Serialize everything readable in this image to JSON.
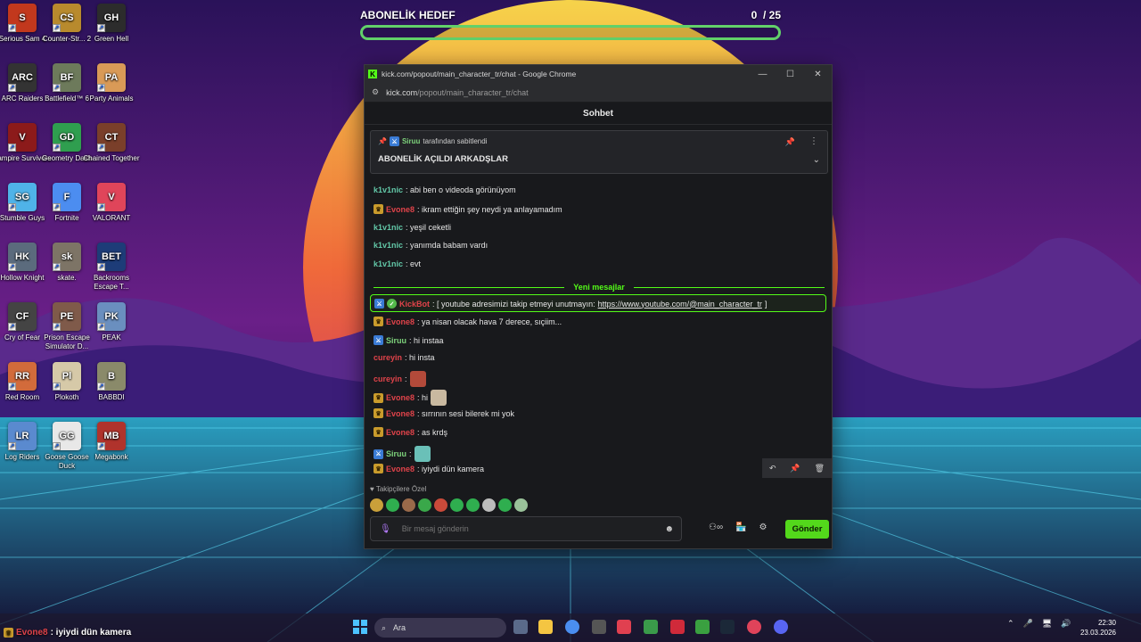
{
  "goal": {
    "label": "ABONELİK HEDEF",
    "current": "0",
    "target": "/ 25",
    "progress": 0
  },
  "desktop": {
    "icons": [
      {
        "label": "Serious Sam 4",
        "glyph": "S",
        "color": "#c2381d"
      },
      {
        "label": "Counter-Str... 2",
        "glyph": "CS",
        "color": "#b88a2d"
      },
      {
        "label": "Green Hell",
        "glyph": "GH",
        "color": "#2c2c2c"
      },
      {
        "label": "ARC Raiders",
        "glyph": "ARC",
        "color": "#333333"
      },
      {
        "label": "Battlefield™ 6",
        "glyph": "BF",
        "color": "#6d7a5b"
      },
      {
        "label": "Party Animals",
        "glyph": "PA",
        "color": "#d99a57"
      },
      {
        "label": "Vampire Survivors",
        "glyph": "V",
        "color": "#8c1a1a"
      },
      {
        "label": "Geometry Dash",
        "glyph": "GD",
        "color": "#2f9e4f"
      },
      {
        "label": "Chained Together",
        "glyph": "CT",
        "color": "#7a3f2a"
      },
      {
        "label": "Stumble Guys",
        "glyph": "SG",
        "color": "#4fb3e8"
      },
      {
        "label": "Fortnite",
        "glyph": "F",
        "color": "#4c8df0"
      },
      {
        "label": "VALORANT",
        "glyph": "V",
        "color": "#e0455a"
      },
      {
        "label": "Hollow Knight",
        "glyph": "HK",
        "color": "#5b6b7d"
      },
      {
        "label": "skate.",
        "glyph": "sk",
        "color": "#7d7466"
      },
      {
        "label": "Backrooms Escape T...",
        "glyph": "BET",
        "color": "#1d3c78"
      },
      {
        "label": "Cry of Fear",
        "glyph": "CF",
        "color": "#444444"
      },
      {
        "label": "Prison Escape Simulator D...",
        "glyph": "PE",
        "color": "#7f5a4a"
      },
      {
        "label": "PEAK",
        "glyph": "PK",
        "color": "#6a8fbf"
      },
      {
        "label": "Red Room",
        "glyph": "RR",
        "color": "#d26b3b"
      },
      {
        "label": "Plokoth",
        "glyph": "Pl",
        "color": "#d6c9a8"
      },
      {
        "label": "BABBDI",
        "glyph": "B",
        "color": "#8a8a6a"
      },
      {
        "label": "Log Riders",
        "glyph": "LR",
        "color": "#5a8acf"
      },
      {
        "label": "Goose Goose Duck",
        "glyph": "GG",
        "color": "#e8e8e8"
      },
      {
        "label": "Megabonk",
        "glyph": "MB",
        "color": "#b0332c"
      }
    ]
  },
  "window": {
    "title": "kick.com/popout/main_character_tr/chat - Google Chrome",
    "url_host": "kick.com",
    "url_path": "/popout/main_character_tr/chat",
    "chat_title": "Sohbet"
  },
  "pinned": {
    "by_user": "Siruu",
    "by_suffix": "tarafından sabitlendi",
    "message": "ABONELİK AÇILDI ARKADŞLAR"
  },
  "chat": {
    "new_messages_label": "Yeni mesajlar",
    "messages": [
      {
        "user": "k1v1nic",
        "text": ": abi ben o videoda görünüyom",
        "color": "#62c7a7"
      },
      {
        "user": "Evone8",
        "text": ": ikram ettiğin şey neydi ya anlayamadım",
        "color": "#e0434a"
      },
      {
        "user": "k1v1nic",
        "text": ": yeşil ceketli",
        "color": "#62c7a7"
      },
      {
        "user": "k1v1nic",
        "text": ": yanımda babam vardı",
        "color": "#62c7a7"
      },
      {
        "user": "k1v1nic",
        "text": ": evt",
        "color": "#62c7a7"
      }
    ],
    "bot": {
      "user": "KickBot",
      "text": ": [ youtube adresimizi takip etmeyi unutmayın: ",
      "link": "https://www.youtube.com/@main_character_tr",
      "close": " ]"
    },
    "new": [
      {
        "user": "Evone8",
        "text": ": ya nisan olacak hava 7 derece, sıçiim...",
        "color": "#e0434a"
      },
      {
        "user": "Siruu",
        "text": ": hi instaa",
        "color": "#7ed37c"
      },
      {
        "user": "cureyin",
        "text": ": hi insta",
        "color": "#e0434a"
      },
      {
        "user": "cureyin",
        "text": ":",
        "color": "#e0434a"
      },
      {
        "user": "Evone8",
        "text": ": hi",
        "color": "#e0434a"
      },
      {
        "user": "Evone8",
        "text": ": sırrının sesi bilerek mi yok",
        "color": "#e0434a"
      },
      {
        "user": "Evone8",
        "text": ": as krdş",
        "color": "#e0434a"
      },
      {
        "user": "Siruu",
        "text": ":",
        "color": "#7ed37c"
      },
      {
        "user": "Evone8",
        "text": ": iyiydi dün kamera",
        "color": "#e0434a"
      }
    ]
  },
  "composer": {
    "follow_only": "Takipçilere Özel",
    "placeholder": "Bir mesaj gönderin",
    "send": "Gönder"
  },
  "overlay": {
    "user": "Evone8",
    "text": ": iyiydi dün kamera"
  },
  "taskbar": {
    "search": "Ara",
    "time": "22:30",
    "date": "23.03.2026"
  }
}
